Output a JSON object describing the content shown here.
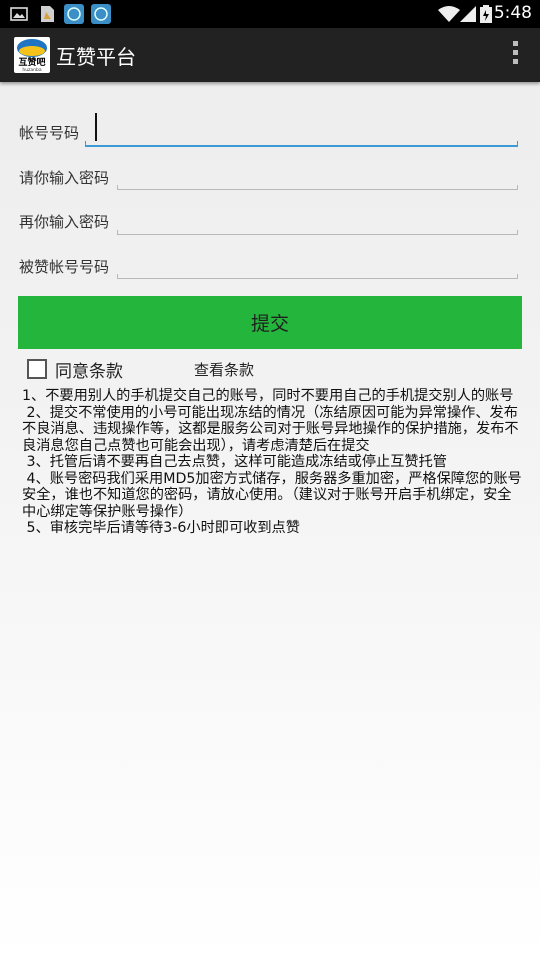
{
  "status_bar": {
    "time": "5:48",
    "left_icons": [
      "image-icon",
      "file-icon",
      "app-icon",
      "app-icon"
    ],
    "right_icons": [
      "wifi-icon",
      "signal-icon",
      "battery-icon"
    ]
  },
  "app_bar": {
    "logo_text": "互赞吧",
    "logo_subtext": "huzanba",
    "title": "互赞平台",
    "menu_icon": "overflow-menu-icon"
  },
  "form": {
    "fields": [
      {
        "label": "帐号号码",
        "value": ""
      },
      {
        "label": "请你输入密码",
        "value": ""
      },
      {
        "label": "再你输入密码",
        "value": ""
      },
      {
        "label": "被赞帐号号码",
        "value": ""
      }
    ],
    "submit_label": "提交",
    "agree_label": "同意条款",
    "agree_checked": false,
    "view_terms_label": "查看条款"
  },
  "notes": [
    "1、不要用别人的手机提交自己的账号，同时不要用自己的手机提交别人的账号",
    " 2、提交不常使用的小号可能出现冻结的情况（冻结原因可能为异常操作、发布不良消息、违规操作等，这都是服务公司对于账号异地操作的保护措施，发布不良消息您自己点赞也可能会出现），请考虑清楚后在提交",
    " 3、托管后请不要再自己去点赞，这样可能造成冻结或停止互赞托管",
    " 4、账号密码我们采用MD5加密方式储存，服务器多重加密，严格保障您的账号安全，谁也不知道您的密码，请放心使用。（建议对于账号开启手机绑定，安全中心绑定等保护账号操作）",
    " 5、审核完毕后请等待3-6小时即可收到点赞"
  ],
  "colors": {
    "submit_bg": "#24b53c",
    "focus_line": "#3a9bd7",
    "app_bar_bg": "#222222"
  }
}
